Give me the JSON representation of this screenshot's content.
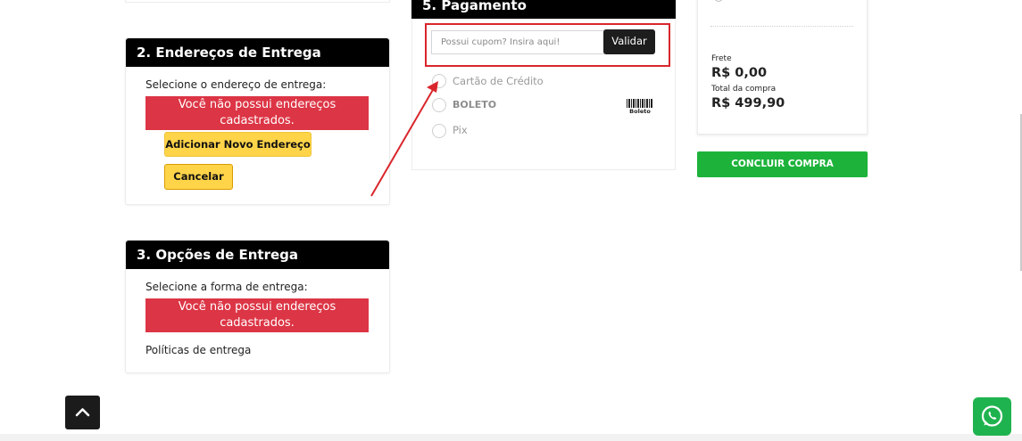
{
  "address_section": {
    "title": "2. Endereços de Entrega",
    "prompt": "Selecione o endereço de entrega:",
    "alert_line1": "Você não possui endereços",
    "alert_line2": "cadastrados.",
    "add_button": "Adicionar Novo Endereço",
    "cancel_button": "Cancelar"
  },
  "delivery_section": {
    "title": "3. Opções de Entrega",
    "prompt": "Selecione a forma de entrega:",
    "alert_line1": "Você não possui endereços",
    "alert_line2": "cadastrados.",
    "policies_label": "Políticas de entrega"
  },
  "payment_section": {
    "title": "5. Pagamento",
    "coupon_placeholder": "Possui cupom? Insira aqui!",
    "validate_button": "Validar",
    "options": [
      {
        "label": "Cartão de Crédito"
      },
      {
        "label": "BOLETO"
      },
      {
        "label": "Pix"
      }
    ],
    "boleto_badge": "Boleto"
  },
  "summary": {
    "shipping_label": "Frete",
    "shipping_value": "R$ 0,00",
    "total_label": "Total da compra",
    "total_value": "R$ 499,90",
    "finish_button": "CONCLUIR COMPRA"
  },
  "colors": {
    "header_bg": "#000000",
    "alert_bg": "#dc3545",
    "yellow_button": "#ffd449",
    "finish_green": "#1db33b",
    "annotation_red": "#d9262c",
    "whatsapp_green": "#1fb34f"
  },
  "icons": {
    "back_to_top": "chevron-up-icon",
    "whatsapp": "whatsapp-icon",
    "boleto": "barcode-icon"
  }
}
